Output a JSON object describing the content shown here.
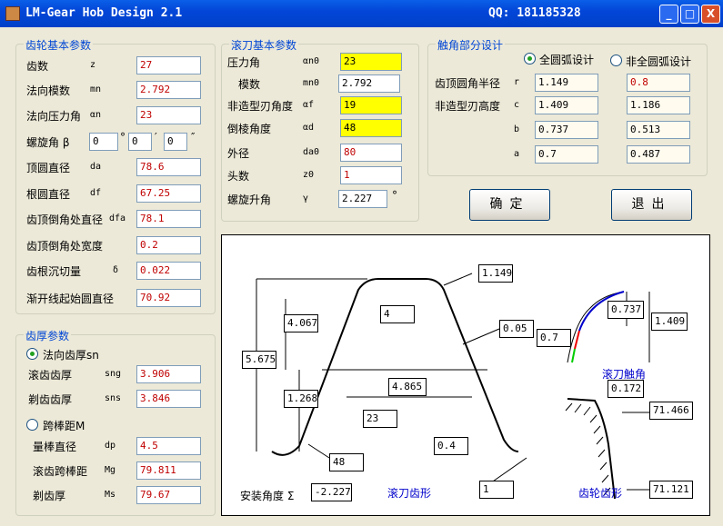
{
  "window": {
    "title": "LM-Gear Hob Design 2.1",
    "qq": "QQ: 181185328",
    "min": "_",
    "max": "□",
    "close": "X"
  },
  "gear": {
    "title": "齿轮基本参数",
    "rows": [
      {
        "label": "齿数",
        "sym": "z",
        "value": "27"
      },
      {
        "label": "法向模数",
        "sym": "mn",
        "value": "2.792"
      },
      {
        "label": "法向压力角",
        "sym": "αn",
        "value": "23"
      },
      {
        "label": "螺旋角 β",
        "sym": "",
        "value": ""
      },
      {
        "label": "顶圆直径",
        "sym": "da",
        "value": "78.6"
      },
      {
        "label": "根圆直径",
        "sym": "df",
        "value": "67.25"
      },
      {
        "label": "齿顶倒角处直径",
        "sym": "dfa",
        "value": "78.1"
      },
      {
        "label": "齿顶倒角处宽度",
        "sym": "",
        "value": "0.2"
      },
      {
        "label": "齿根沉切量",
        "sym": "δ",
        "value": "0.022"
      },
      {
        "label": "渐开线起始圆直径",
        "sym": "",
        "value": "70.92"
      }
    ],
    "helix": {
      "deg": "0",
      "min": "0",
      "sec": "0",
      "u_deg": "°",
      "u_min": "′",
      "u_sec": "″"
    }
  },
  "thick": {
    "title": "齿厚参数",
    "opt1": "法向齿厚sn",
    "rows1": [
      {
        "label": "滚齿齿厚",
        "sym": "sng",
        "value": "3.906"
      },
      {
        "label": "剃齿齿厚",
        "sym": "sns",
        "value": "3.846"
      }
    ],
    "opt2": "跨棒距M",
    "rows2": [
      {
        "label": "量棒直径",
        "sym": "dp",
        "value": "4.5"
      },
      {
        "label": "滚齿跨棒距",
        "sym": "Mg",
        "value": "79.811"
      },
      {
        "label": "剃齿厚",
        "sym": "Ms",
        "value": "79.67"
      }
    ]
  },
  "hob": {
    "title": "滚刀基本参数",
    "rows": [
      {
        "label": "压力角",
        "sym": "αn0",
        "value": "23"
      },
      {
        "label": "模数",
        "sym": "mn0",
        "value": "2.792"
      },
      {
        "label": "非造型刃角度",
        "sym": "αf",
        "value": "19"
      },
      {
        "label": "倒棱角度",
        "sym": "αd",
        "value": "48"
      },
      {
        "label": "外径",
        "sym": "da0",
        "value": "80"
      },
      {
        "label": "头数",
        "sym": "z0",
        "value": "1"
      },
      {
        "label": "螺旋升角",
        "sym": "γ",
        "value": "2.227"
      }
    ],
    "deg": "°"
  },
  "contact": {
    "title": "触角部分设计",
    "opt1": "全圆弧设计",
    "opt2": "非全圆弧设计",
    "rows": [
      {
        "label": "齿顶圆角半径",
        "sym": "r",
        "v1": "1.149",
        "v2": "0.8"
      },
      {
        "label": "非造型刃高度",
        "sym": "c",
        "v1": "1.409",
        "v2": "1.186"
      },
      {
        "label": "",
        "sym": "b",
        "v1": "0.737",
        "v2": "0.513"
      },
      {
        "label": "",
        "sym": "a",
        "v1": "0.7",
        "v2": "0.487"
      }
    ]
  },
  "buttons": {
    "ok": "确定",
    "exit": "退出"
  },
  "drawing": {
    "dims": {
      "tip_r": "1.149",
      "h1": "4.067",
      "h_total": "5.675",
      "h2": "1.268",
      "ang_top": "4",
      "ang_pa": "23",
      "flank": "0.05",
      "width": "4.865",
      "chamfer": "48",
      "tip_w": "0.4",
      "root": "1",
      "b": "0.737",
      "a": "0.7",
      "c": "1.409",
      "gear_c": "0.172",
      "d1": "71.466",
      "d2": "71.121",
      "install": "-2.227"
    },
    "deg": "°",
    "install_label": "安装角度  Σ",
    "hob_caption": "滚刀齿形",
    "tip_caption": "滚刀触角",
    "gear_caption": "齿轮齿形"
  }
}
